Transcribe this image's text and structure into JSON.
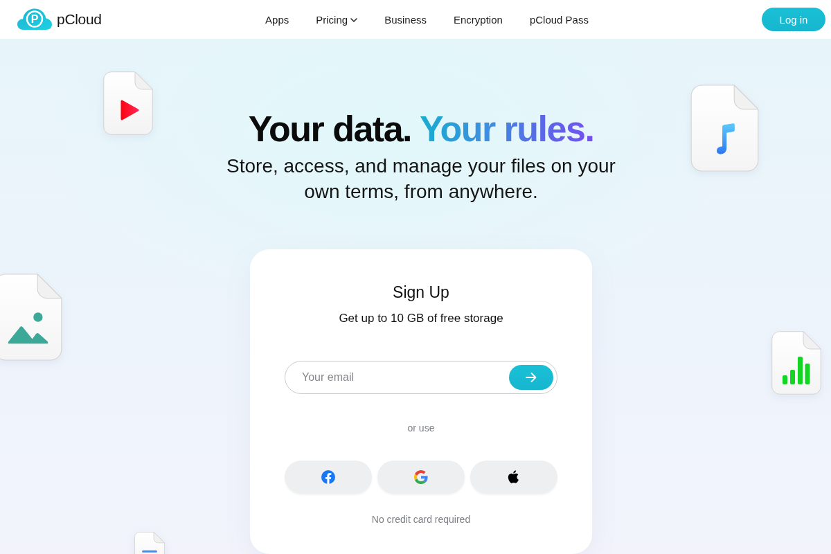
{
  "header": {
    "logo_mark": "P",
    "logo_text": "pCloud",
    "nav": [
      {
        "label": "Apps",
        "has_dropdown": false
      },
      {
        "label": "Pricing",
        "has_dropdown": true
      },
      {
        "label": "Business",
        "has_dropdown": false
      },
      {
        "label": "Encryption",
        "has_dropdown": false
      },
      {
        "label": "pCloud Pass",
        "has_dropdown": false
      }
    ],
    "login_button": "Log in"
  },
  "hero": {
    "title": "Your data.",
    "title_accent": "Your rules.",
    "subtitle": "Store, access, and manage your files on your own terms, from anywhere."
  },
  "signup": {
    "title": "Sign Up",
    "subtitle": "Get up to 10 GB of free storage",
    "email": {
      "placeholder": "Your email"
    },
    "divider_text": "or use",
    "social_buttons": [
      {
        "kind": "facebook"
      },
      {
        "kind": "google"
      },
      {
        "kind": "apple"
      }
    ],
    "note": "No credit card required"
  }
}
